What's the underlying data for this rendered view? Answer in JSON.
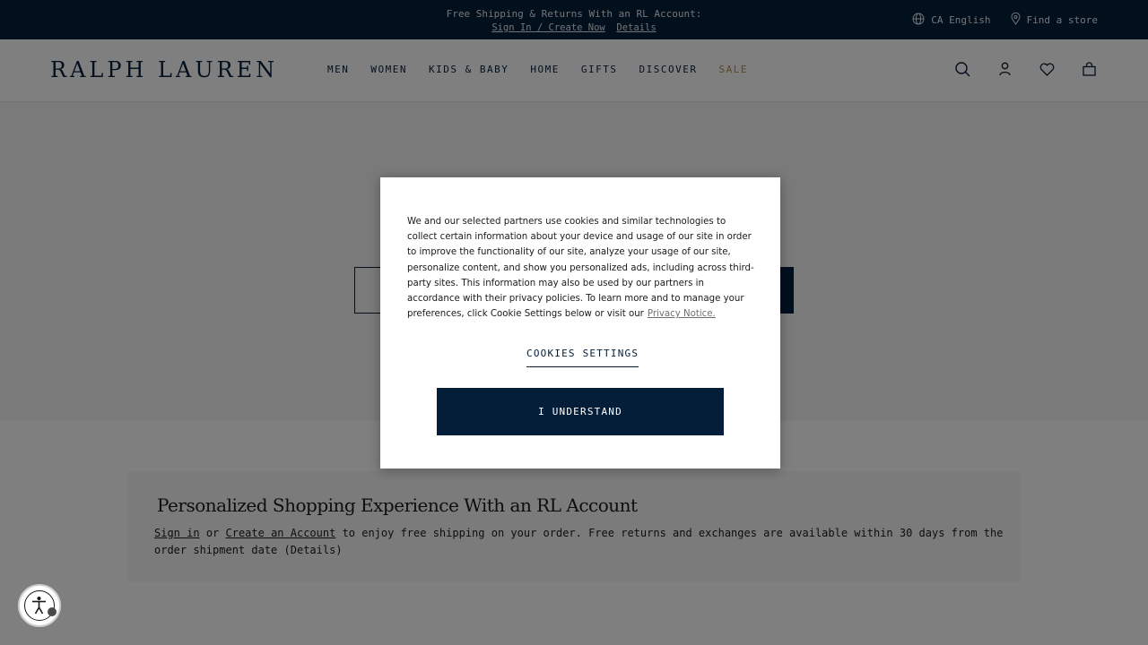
{
  "promo": {
    "message": "Free Shipping & Returns With an RL Account:",
    "signin_link": "Sign In / Create Now",
    "details_link": "Details",
    "locale": "CA English",
    "store_link": "Find a store"
  },
  "header": {
    "logo": "RALPH LAUREN",
    "nav": [
      "MEN",
      "WOMEN",
      "KIDS & BABY",
      "HOME",
      "GIFTS",
      "DISCOVER",
      "SALE"
    ],
    "icons": [
      "search-icon",
      "account-icon",
      "wishlist-icon",
      "bag-icon"
    ]
  },
  "account_banner": {
    "title": "Personalized Shopping Experience With an RL Account",
    "signin": "Sign in",
    "or": "or",
    "create": "Create an Account",
    "body": "to enjoy free shipping on your order. Free returns and exchanges are available within 30 days from the order shipment date",
    "details": "(Details)"
  },
  "cookie_modal": {
    "text": "We and our selected partners use cookies and similar technologies to collect certain information about your device and usage of our site in order to improve the functionality of our site, analyze your usage of our site, personalize content, and show you personalized ads, including across third-party sites. This information may also be used by our partners in accordance with their privacy policies. To learn more and to manage your preferences, click Cookie Settings below or visit our",
    "privacy_link": "Privacy Notice.",
    "settings_label": "COOKIES SETTINGS",
    "accept_label": "I UNDERSTAND"
  },
  "colors": {
    "navy": "#041e3a",
    "sale": "#b08b54"
  }
}
